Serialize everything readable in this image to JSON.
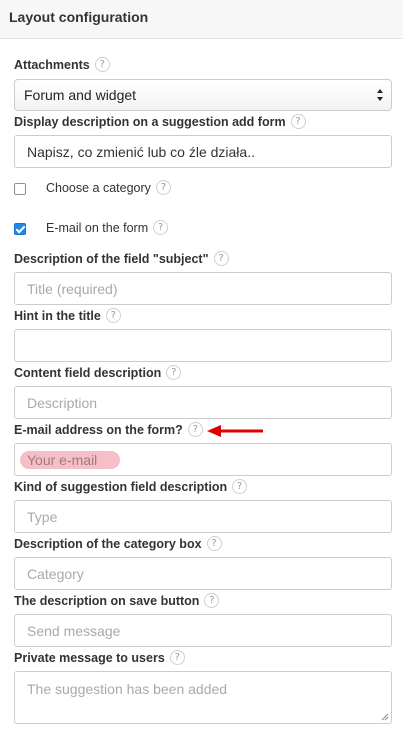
{
  "header": {
    "title": "Layout configuration"
  },
  "help_glyph": "?",
  "attachments": {
    "label": "Attachments",
    "selected": "Forum and widget"
  },
  "display_description": {
    "label": "Display description on a suggestion add form",
    "value": "Napisz, co zmienić lub co źle działa.."
  },
  "choose_category": {
    "label": "Choose a category",
    "checked": false
  },
  "email_on_form": {
    "label": "E-mail on the form",
    "checked": true
  },
  "subject_description": {
    "label": "Description of the field \"subject\"",
    "placeholder": "Title (required)"
  },
  "hint_title": {
    "label": "Hint in the title",
    "value": ""
  },
  "content_description": {
    "label": "Content field description",
    "placeholder": "Description"
  },
  "email_address": {
    "label": "E-mail address on the form?",
    "placeholder": "Your e-mail"
  },
  "kind_description": {
    "label": "Kind of suggestion field description",
    "placeholder": "Type"
  },
  "category_box": {
    "label": "Description of the category box",
    "placeholder": "Category"
  },
  "save_button_description": {
    "label": "The description on save button",
    "placeholder": "Send message"
  },
  "private_message": {
    "label": "Private message to users",
    "placeholder": "The suggestion has been added"
  },
  "colors": {
    "accent": "#1e88e5",
    "annotation": "#e00000",
    "highlight": "#f5b4bd"
  }
}
